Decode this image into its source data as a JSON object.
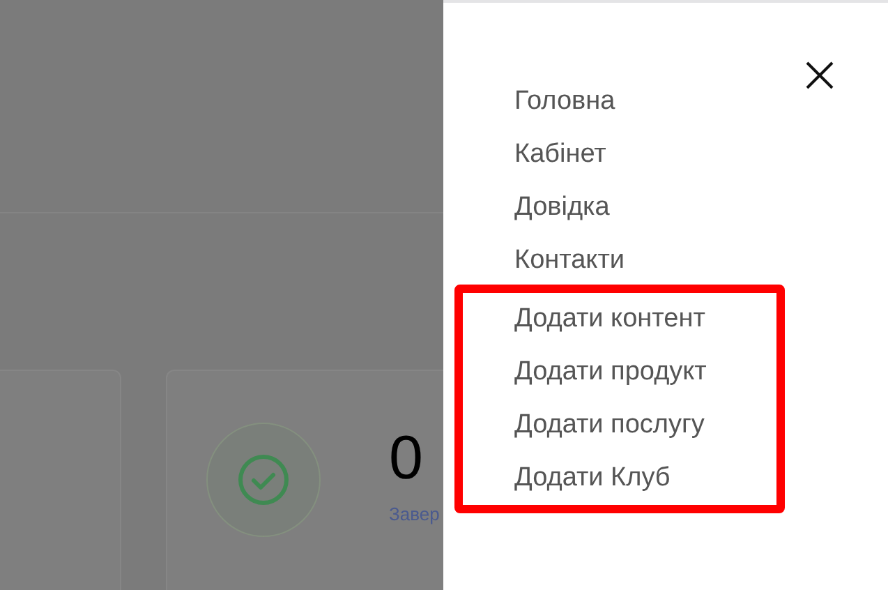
{
  "stat_card": {
    "value": "0",
    "label": "Завер"
  },
  "menu": {
    "items": [
      {
        "label": "Головна",
        "highlighted": false
      },
      {
        "label": "Кабінет",
        "highlighted": false
      },
      {
        "label": "Довідка",
        "highlighted": false
      },
      {
        "label": "Контакти",
        "highlighted": false
      },
      {
        "label": "Додати контент",
        "highlighted": true
      },
      {
        "label": "Додати продукт",
        "highlighted": true
      },
      {
        "label": "Додати послугу",
        "highlighted": true
      },
      {
        "label": "Додати Клуб",
        "highlighted": true
      }
    ]
  }
}
